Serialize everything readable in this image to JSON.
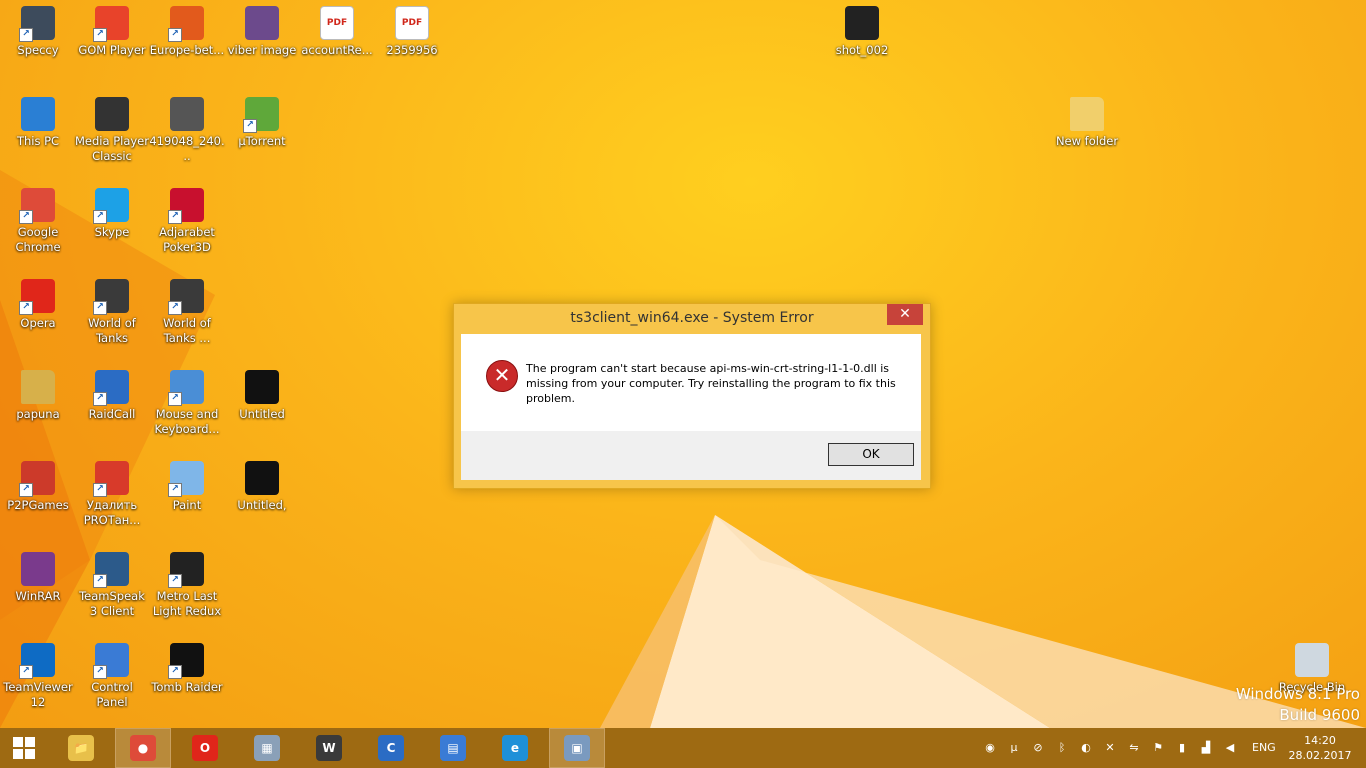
{
  "desktop_icons": [
    {
      "label": "Speccy",
      "icon": "speccy-icon",
      "color": "#3d4b5c"
    },
    {
      "label": "GOM Player",
      "icon": "gom-player-icon",
      "color": "#e8432a"
    },
    {
      "label": "Europe-bet...",
      "icon": "europebet-icon",
      "color": "#e25a1c"
    },
    {
      "label": "viber image",
      "icon": "image-file-icon",
      "color": "#6c4a8c"
    },
    {
      "label": "accountRe...",
      "icon": "pdf-icon",
      "color": "#ffffff"
    },
    {
      "label": "2359956",
      "icon": "pdf-icon",
      "color": "#ffffff"
    },
    {
      "label": "shot_002",
      "icon": "image-file-icon",
      "color": "#222222"
    },
    {
      "label": "This PC",
      "icon": "this-pc-icon",
      "color": "#2a7fd4"
    },
    {
      "label": "Media Player Classic",
      "icon": "media-player-classic-icon",
      "color": "#333333"
    },
    {
      "label": "419048_240...",
      "icon": "image-file-icon",
      "color": "#555555"
    },
    {
      "label": "µTorrent",
      "icon": "utorrent-icon",
      "color": "#5fa83a"
    },
    {
      "label": "New folder",
      "icon": "folder-icon",
      "color": "#f1cf6b"
    },
    {
      "label": "Google Chrome",
      "icon": "chrome-icon",
      "color": "#de4b39"
    },
    {
      "label": "Skype",
      "icon": "skype-icon",
      "color": "#1da1e6"
    },
    {
      "label": "Adjarabet Poker3D",
      "icon": "poker3d-icon",
      "color": "#c8102e"
    },
    {
      "label": "Opera",
      "icon": "opera-icon",
      "color": "#e0261a"
    },
    {
      "label": "World of Tanks",
      "icon": "world-of-tanks-icon",
      "color": "#3a3a3a"
    },
    {
      "label": "World of Tanks ...",
      "icon": "world-of-tanks-icon",
      "color": "#3a3a3a"
    },
    {
      "label": "papuna",
      "icon": "user-folder-icon",
      "color": "#d7b04a"
    },
    {
      "label": "RaidCall",
      "icon": "raidcall-icon",
      "color": "#2b6cc4"
    },
    {
      "label": "Mouse and Keyboard...",
      "icon": "mouse-keyboard-icon",
      "color": "#4a8ed6"
    },
    {
      "label": "Untitled",
      "icon": "image-file-icon",
      "color": "#111111"
    },
    {
      "label": "P2PGames",
      "icon": "p2pgames-icon",
      "color": "#cc3a2a"
    },
    {
      "label": "Удалить PROТан...",
      "icon": "uninstall-icon",
      "color": "#d83a2a"
    },
    {
      "label": "Paint",
      "icon": "paint-icon",
      "color": "#7fb6e8"
    },
    {
      "label": "Untitled,",
      "icon": "image-file-icon",
      "color": "#111111"
    },
    {
      "label": "WinRAR",
      "icon": "winrar-icon",
      "color": "#7a3a8c"
    },
    {
      "label": "TeamSpeak 3 Client",
      "icon": "teamspeak-icon",
      "color": "#2c5a8a"
    },
    {
      "label": "Metro Last Light Redux",
      "icon": "metro-icon",
      "color": "#222222"
    },
    {
      "label": "TeamViewer 12",
      "icon": "teamviewer-icon",
      "color": "#0e6bc4"
    },
    {
      "label": "Control Panel",
      "icon": "control-panel-icon",
      "color": "#3a7bd5"
    },
    {
      "label": "Tomb Raider",
      "icon": "tomb-raider-icon",
      "color": "#111111"
    },
    {
      "label": "Recycle Bin",
      "icon": "recycle-bin-icon",
      "color": "#cfd8e0"
    }
  ],
  "dialog": {
    "title": "ts3client_win64.exe - System Error",
    "close_glyph": "✕",
    "message": "The program can't start because api-ms-win-crt-string-l1-1-0.dll is missing from your computer. Try reinstalling the program to fix this problem.",
    "ok_label": "OK",
    "error_glyph": "✕"
  },
  "watermark": {
    "line1": "Windows 8.1 Pro",
    "line2": "Build 9600"
  },
  "taskbar": {
    "start_icon": "windows-start-icon",
    "pinned": [
      {
        "name": "file-explorer-icon",
        "glyph": "📁",
        "color": "#e8c04a",
        "active": false
      },
      {
        "name": "chrome-icon",
        "glyph": "●",
        "color": "#de4b39",
        "active": true
      },
      {
        "name": "opera-icon",
        "glyph": "O",
        "color": "#e0261a",
        "active": false
      },
      {
        "name": "calculator-icon",
        "glyph": "▦",
        "color": "#8aa0b8",
        "active": false
      },
      {
        "name": "world-of-tanks-icon",
        "glyph": "W",
        "color": "#3a3a3a",
        "active": false
      },
      {
        "name": "ccleaner-icon",
        "glyph": "C",
        "color": "#2b6cc4",
        "active": false
      },
      {
        "name": "media-player-icon",
        "glyph": "▤",
        "color": "#3a7bd5",
        "active": false
      },
      {
        "name": "internet-explorer-icon",
        "glyph": "e",
        "color": "#1e90d8",
        "active": false
      },
      {
        "name": "system-error-window-icon",
        "glyph": "▣",
        "color": "#7a9abf",
        "active": true
      }
    ],
    "tray_icons": [
      "teamviewer-tray-icon",
      "utorrent-tray-icon",
      "antivirus-tray-icon",
      "bluetooth-icon",
      "teamspeak-tray-icon",
      "network-disabled-icon",
      "usb-icon",
      "flag-icon",
      "battery-icon",
      "signal-icon",
      "volume-icon"
    ],
    "language": "ENG",
    "time": "14:20",
    "date": "28.02.2017"
  },
  "colors": {
    "desktop": "#fbb51a",
    "taskbar": "#9e6a12",
    "dialog_frame": "#f7c54a",
    "close_button": "#c7433a"
  }
}
